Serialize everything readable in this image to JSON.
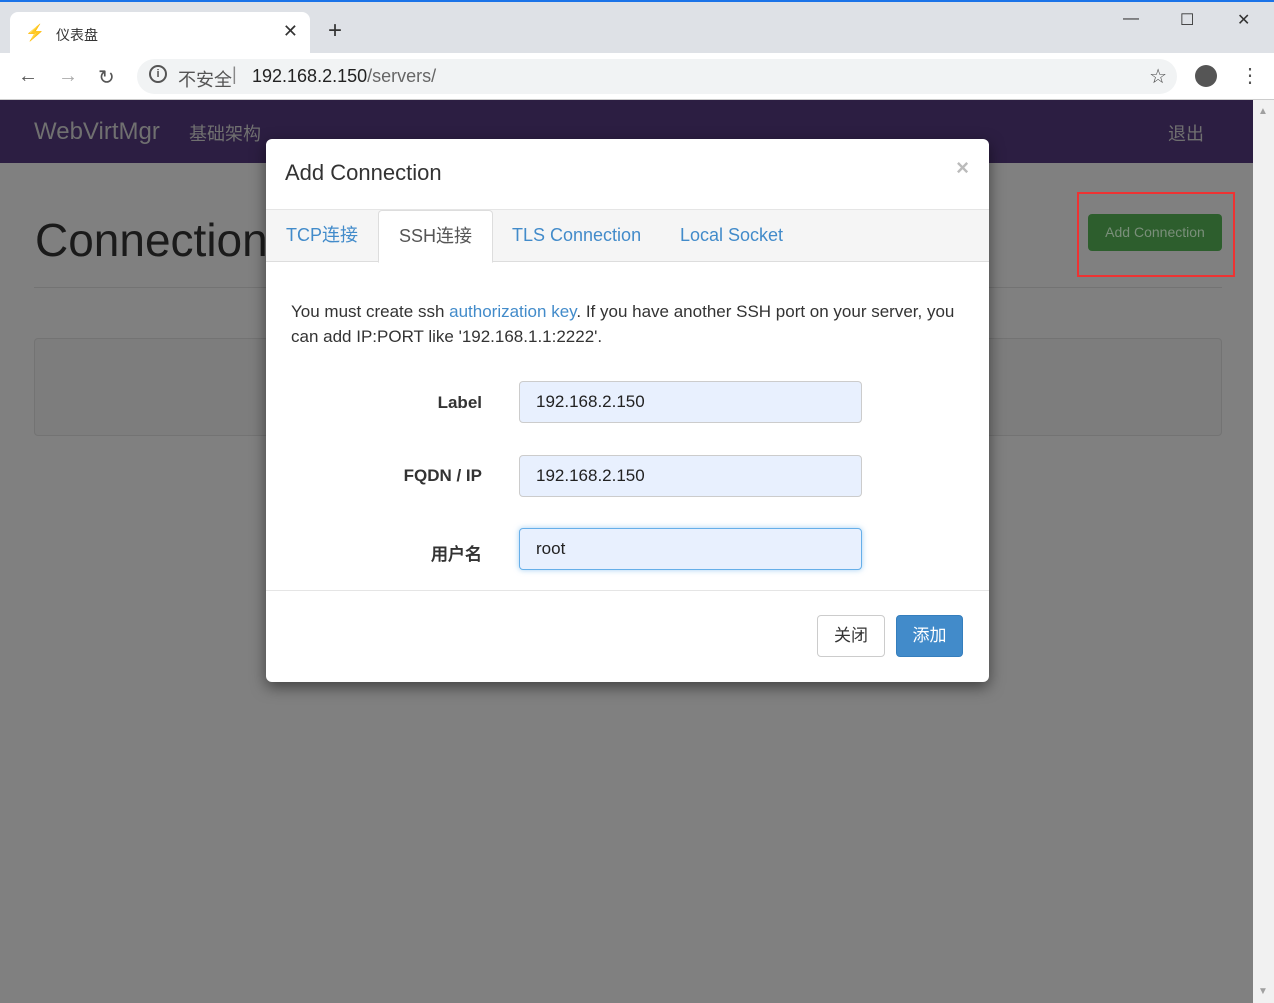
{
  "browser": {
    "tab_title": "仪表盘",
    "url_insecure": "不安全",
    "url_host": "192.168.2.150",
    "url_path": "/servers/"
  },
  "navbar": {
    "brand": "WebVirtMgr",
    "infrastructure": "基础架构",
    "logout": "退出"
  },
  "page": {
    "title": "Connections",
    "add_button": "Add Connection"
  },
  "modal": {
    "title": "Add Connection",
    "close": "×",
    "tabs": [
      {
        "label": "TCP连接"
      },
      {
        "label": "SSH连接",
        "active": true
      },
      {
        "label": "TLS Connection"
      },
      {
        "label": "Local Socket"
      }
    ],
    "desc_before": "You must create ssh ",
    "desc_link": "authorization key",
    "desc_after": ". If you have another SSH port on your server, you can add IP:PORT like '192.168.1.1:2222'.",
    "fields": [
      {
        "label": "Label",
        "value": "192.168.2.150"
      },
      {
        "label": "FQDN / IP",
        "value": "192.168.2.150"
      },
      {
        "label": "用户名",
        "value": "root"
      }
    ],
    "close_button": "关闭",
    "add_button": "添加"
  }
}
